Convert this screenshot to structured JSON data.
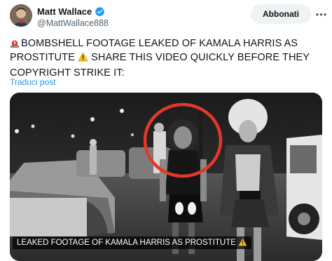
{
  "author": {
    "name": "Matt Wallace",
    "handle": "@MattWallace888",
    "verified": true,
    "avatar_icon": "profile-photo"
  },
  "follow_button": {
    "label": "Abbonati"
  },
  "more_menu": {
    "icon": "more-dots-icon"
  },
  "post": {
    "siren_icon": "rotating-light-emoji",
    "text_part1": "BOMBSHELL FOOTAGE LEAKED OF KAMALA HARRIS AS PROSTITUTE",
    "warning_icon": "warning-emoji",
    "text_part2": "SHARE THIS VIDEO QUICKLY BEFORE THEY COPYRIGHT STRIKE IT:"
  },
  "translate_link": {
    "label": "Traduci post"
  },
  "media": {
    "caption": "LEAKED FOOTAGE OF KAMALA HARRIS AS PROSTITUTE",
    "caption_icon": "warning-emoji",
    "highlight_color": "#e0392b"
  },
  "colors": {
    "accent": "#1d9bf0",
    "secondary_text": "#536471",
    "button_bg": "#eff3f4"
  }
}
